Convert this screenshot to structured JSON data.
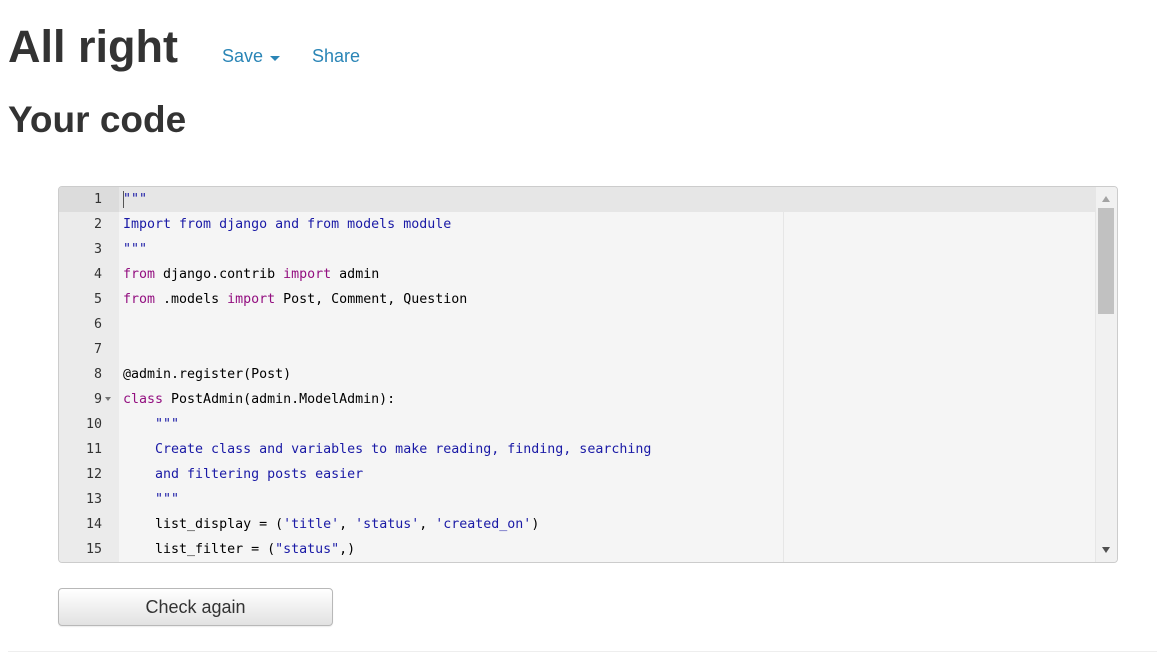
{
  "header": {
    "title": "All right",
    "save_label": "Save",
    "share_label": "Share"
  },
  "section_title": "Your code",
  "editor": {
    "lines": [
      {
        "number": "1",
        "tokens": [
          {
            "text": "\"\"\"",
            "type": "doc"
          }
        ]
      },
      {
        "number": "2",
        "tokens": [
          {
            "text": "Import from django and from models module",
            "type": "doc"
          }
        ]
      },
      {
        "number": "3",
        "tokens": [
          {
            "text": "\"\"\"",
            "type": "doc"
          }
        ]
      },
      {
        "number": "4",
        "tokens": [
          {
            "text": "from",
            "type": "kw"
          },
          {
            "text": " django.contrib ",
            "type": "plain"
          },
          {
            "text": "import",
            "type": "kw"
          },
          {
            "text": " admin",
            "type": "plain"
          }
        ]
      },
      {
        "number": "5",
        "tokens": [
          {
            "text": "from",
            "type": "kw"
          },
          {
            "text": " .models ",
            "type": "plain"
          },
          {
            "text": "import",
            "type": "kw"
          },
          {
            "text": " Post, Comment, Question",
            "type": "plain"
          }
        ]
      },
      {
        "number": "6",
        "tokens": []
      },
      {
        "number": "7",
        "tokens": []
      },
      {
        "number": "8",
        "tokens": [
          {
            "text": "@admin.register(Post)",
            "type": "plain"
          }
        ]
      },
      {
        "number": "9",
        "fold": true,
        "tokens": [
          {
            "text": "class",
            "type": "kw"
          },
          {
            "text": " PostAdmin(admin.ModelAdmin):",
            "type": "plain"
          }
        ]
      },
      {
        "number": "10",
        "tokens": [
          {
            "text": "    \"\"\"",
            "type": "doc"
          }
        ]
      },
      {
        "number": "11",
        "tokens": [
          {
            "text": "    Create class and variables to make reading, finding, searching",
            "type": "doc"
          }
        ]
      },
      {
        "number": "12",
        "tokens": [
          {
            "text": "    and filtering posts easier",
            "type": "doc"
          }
        ]
      },
      {
        "number": "13",
        "tokens": [
          {
            "text": "    \"\"\"",
            "type": "doc"
          }
        ]
      },
      {
        "number": "14",
        "tokens": [
          {
            "text": "    list_display = (",
            "type": "plain"
          },
          {
            "text": "'title'",
            "type": "str"
          },
          {
            "text": ", ",
            "type": "plain"
          },
          {
            "text": "'status'",
            "type": "str"
          },
          {
            "text": ", ",
            "type": "plain"
          },
          {
            "text": "'created_on'",
            "type": "str"
          },
          {
            "text": ")",
            "type": "plain"
          }
        ]
      },
      {
        "number": "15",
        "tokens": [
          {
            "text": "    list_filter = (",
            "type": "plain"
          },
          {
            "text": "\"status\"",
            "type": "str"
          },
          {
            "text": ",)",
            "type": "plain"
          }
        ]
      }
    ]
  },
  "check_button_label": "Check again",
  "colors": {
    "link": "#2a85b6",
    "keyword": "#930f80",
    "docstring": "#1a1aa6"
  }
}
